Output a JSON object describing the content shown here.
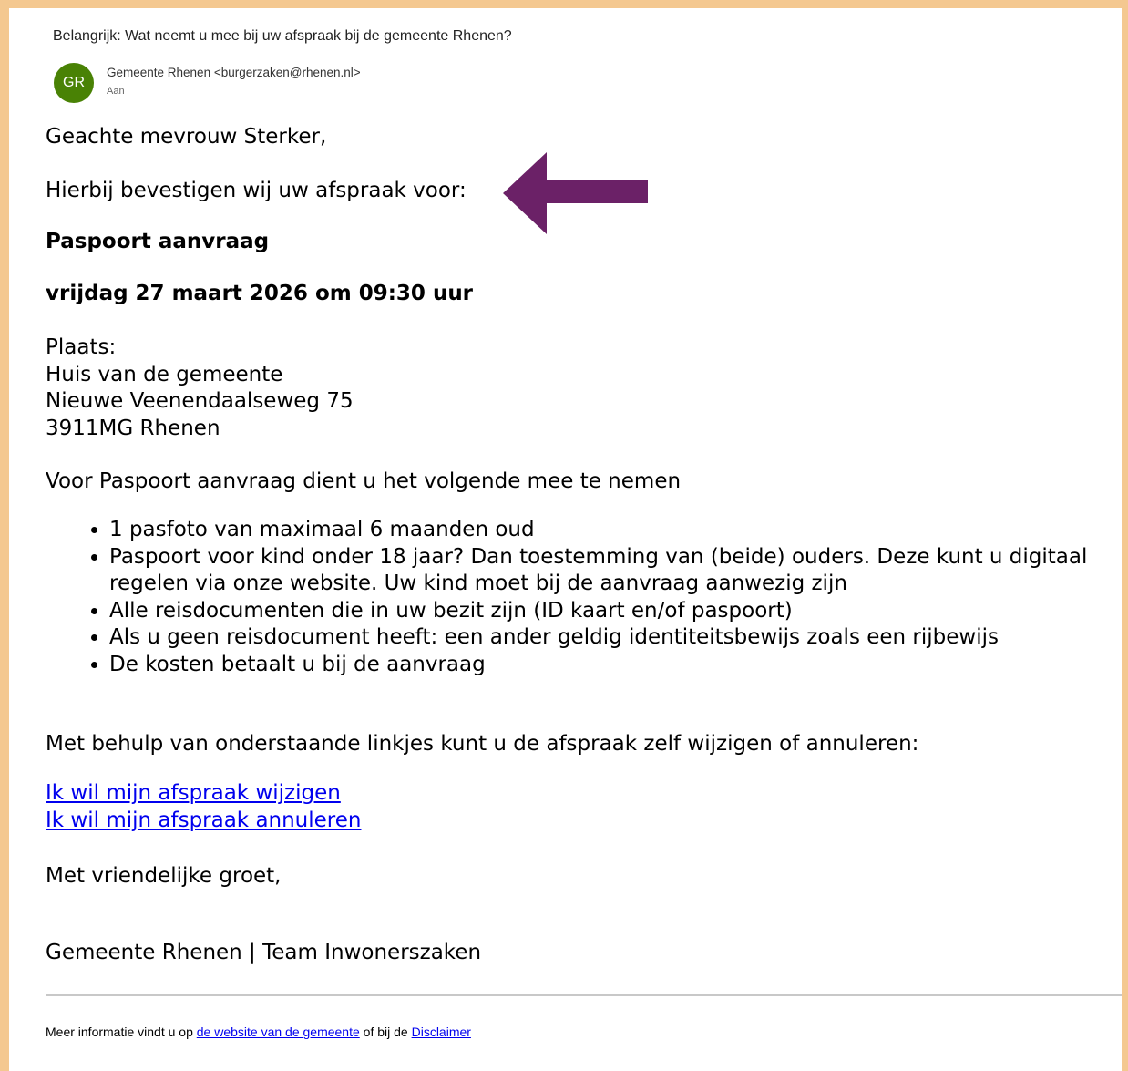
{
  "email": {
    "subject": "Belangrijk: Wat neemt u mee bij uw afspraak bij de gemeente Rhenen?",
    "sender_initials": "GR",
    "sender": "Gemeente Rhenen <burgerzaken@rhenen.nl>",
    "to_label": "Aan",
    "avatar_color": "#498205"
  },
  "body": {
    "greeting": "Geachte mevrouw Sterker,",
    "confirm_line": "Hierbij bevestigen wij uw afspraak voor:",
    "appointment_type": "Paspoort aanvraag",
    "appointment_datetime": "vrijdag 27 maart 2026 om 09:30 uur",
    "location_label": "Plaats:",
    "location_name": "Huis van de gemeente",
    "location_street": "Nieuwe Veenendaalseweg 75",
    "location_city": "3911MG Rhenen",
    "requirements_intro": "Voor Paspoort aanvraag dient u het volgende mee te nemen",
    "requirements": [
      "1 pasfoto van maximaal 6 maanden oud",
      "Paspoort voor kind onder 18 jaar? Dan toestemming van (beide) ouders. Deze kunt u digitaal regelen via onze website. Uw kind moet bij de aanvraag aanwezig zijn",
      "Alle reisdocumenten die in uw bezit zijn (ID kaart en/of paspoort)",
      "Als u geen reisdocument heeft: een ander geldig identiteitsbewijs zoals een rijbewijs",
      "De kosten betaalt u bij de aanvraag"
    ],
    "links_intro": "Met behulp van onderstaande linkjes kunt u de afspraak zelf wijzigen of annuleren:",
    "link_change": "Ik wil mijn afspraak wijzigen",
    "link_cancel": "Ik wil mijn afspraak annuleren",
    "closing": "Met vriendelijke groet,",
    "signature": "Gemeente Rhenen | Team Inwonerszaken"
  },
  "footer": {
    "text_before": "Meer informatie vindt u op ",
    "website_link": "de website van de gemeente",
    "text_middle": " of bij de ",
    "disclaimer_link": "Disclaimer"
  },
  "annotation": {
    "arrow_color": "#6b2167",
    "arrow_direction": "left"
  },
  "frame": {
    "border_color": "#f4c890"
  }
}
